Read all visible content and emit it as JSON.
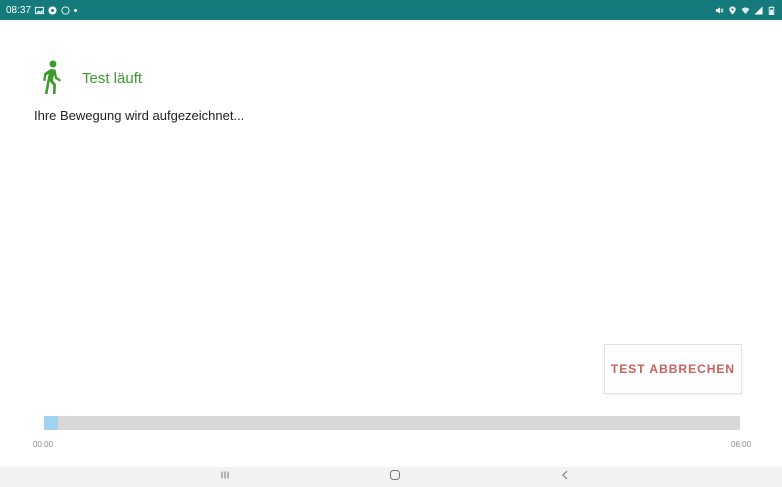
{
  "status_bar": {
    "time": "08:37",
    "left_icons": [
      "image-icon",
      "notification-icon",
      "circle-icon",
      "dot-icon"
    ],
    "right_icons": [
      "mute-icon",
      "location-icon",
      "wifi-icon",
      "signal-icon",
      "battery-icon"
    ]
  },
  "test": {
    "title": "Test läuft",
    "subtitle": "Ihre Bewegung wird aufgezeichnet...",
    "cancel_label": "TEST ABBRECHEN"
  },
  "progress": {
    "start_label": "00:00",
    "end_label": "06:00",
    "fraction": 0.02
  },
  "navigation": {
    "buttons": [
      "recent-apps-icon",
      "home-icon",
      "back-icon"
    ]
  },
  "colors": {
    "status_bar": "#147a7c",
    "accent_green": "#3d9a2f",
    "cancel_text": "#c8605e",
    "progress_fill": "#9fd3f1",
    "progress_track": "#d8d8d8"
  }
}
